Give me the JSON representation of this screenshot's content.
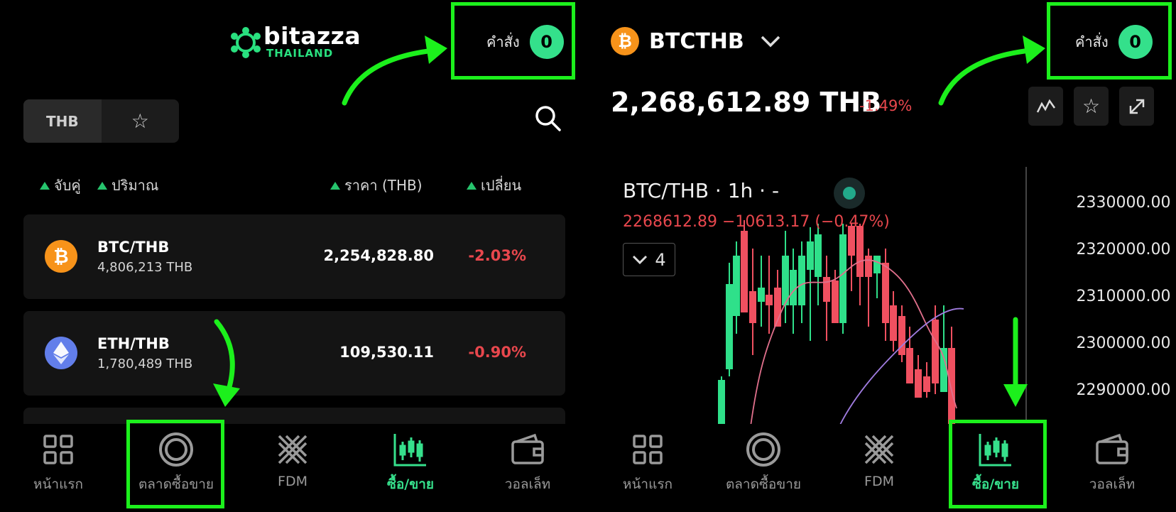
{
  "left": {
    "logo": {
      "name": "bitazza",
      "sub": "THAILAND"
    },
    "orders": {
      "label": "คำสั่ง",
      "count": "0"
    },
    "tabs": {
      "active": "THB",
      "favorites_icon": "star-icon"
    },
    "search_icon": "search-icon",
    "columns": {
      "pair": "จับคู่",
      "volume": "ปริมาณ",
      "price": "ราคา (THB)",
      "change": "เปลี่ยน"
    },
    "rows": [
      {
        "pair": "BTC/THB",
        "volume": "4,806,213 THB",
        "price": "2,254,828.80",
        "change": "-2.03%",
        "icon": "bitcoin-icon",
        "color": "#f7931a"
      },
      {
        "pair": "ETH/THB",
        "volume": "1,780,489 THB",
        "price": "109,530.11",
        "change": "-0.90%",
        "icon": "ethereum-icon",
        "color": "#627eea"
      }
    ],
    "nav": [
      {
        "label": "หน้าแรก",
        "icon": "grid-icon"
      },
      {
        "label": "ตลาดซื้อขาย",
        "icon": "market-ring-icon"
      },
      {
        "label": "FDM",
        "icon": "fdm-icon"
      },
      {
        "label": "ซื้อ/ขาย",
        "icon": "candlestick-icon",
        "active": true
      },
      {
        "label": "วอลเล็ท",
        "icon": "wallet-icon"
      }
    ]
  },
  "right": {
    "symbol": "BTCTHB",
    "orders": {
      "label": "คำสั่ง",
      "count": "0"
    },
    "price": "2,268,612.89 THB",
    "change": "-1.49%",
    "tools": [
      "indicator-icon",
      "star-icon",
      "expand-icon"
    ],
    "chart": {
      "title": "BTC/THB · 1h · -",
      "ohlc": "2268612.89 −10613.17 (−0.47%)",
      "collapse_count": "4",
      "y_ticks": [
        "2330000.00",
        "2320000.00",
        "2310000.00",
        "2300000.00",
        "2290000.00"
      ]
    },
    "nav": [
      {
        "label": "หน้าแรก",
        "icon": "grid-icon"
      },
      {
        "label": "ตลาดซื้อขาย",
        "icon": "market-ring-icon"
      },
      {
        "label": "FDM",
        "icon": "fdm-icon"
      },
      {
        "label": "ซื้อ/ขาย",
        "icon": "candlestick-icon",
        "active": true
      },
      {
        "label": "วอลเล็ท",
        "icon": "wallet-icon"
      }
    ]
  },
  "colors": {
    "accent": "#36e08c",
    "negative": "#e8474d",
    "highlight": "#1cf01c"
  }
}
